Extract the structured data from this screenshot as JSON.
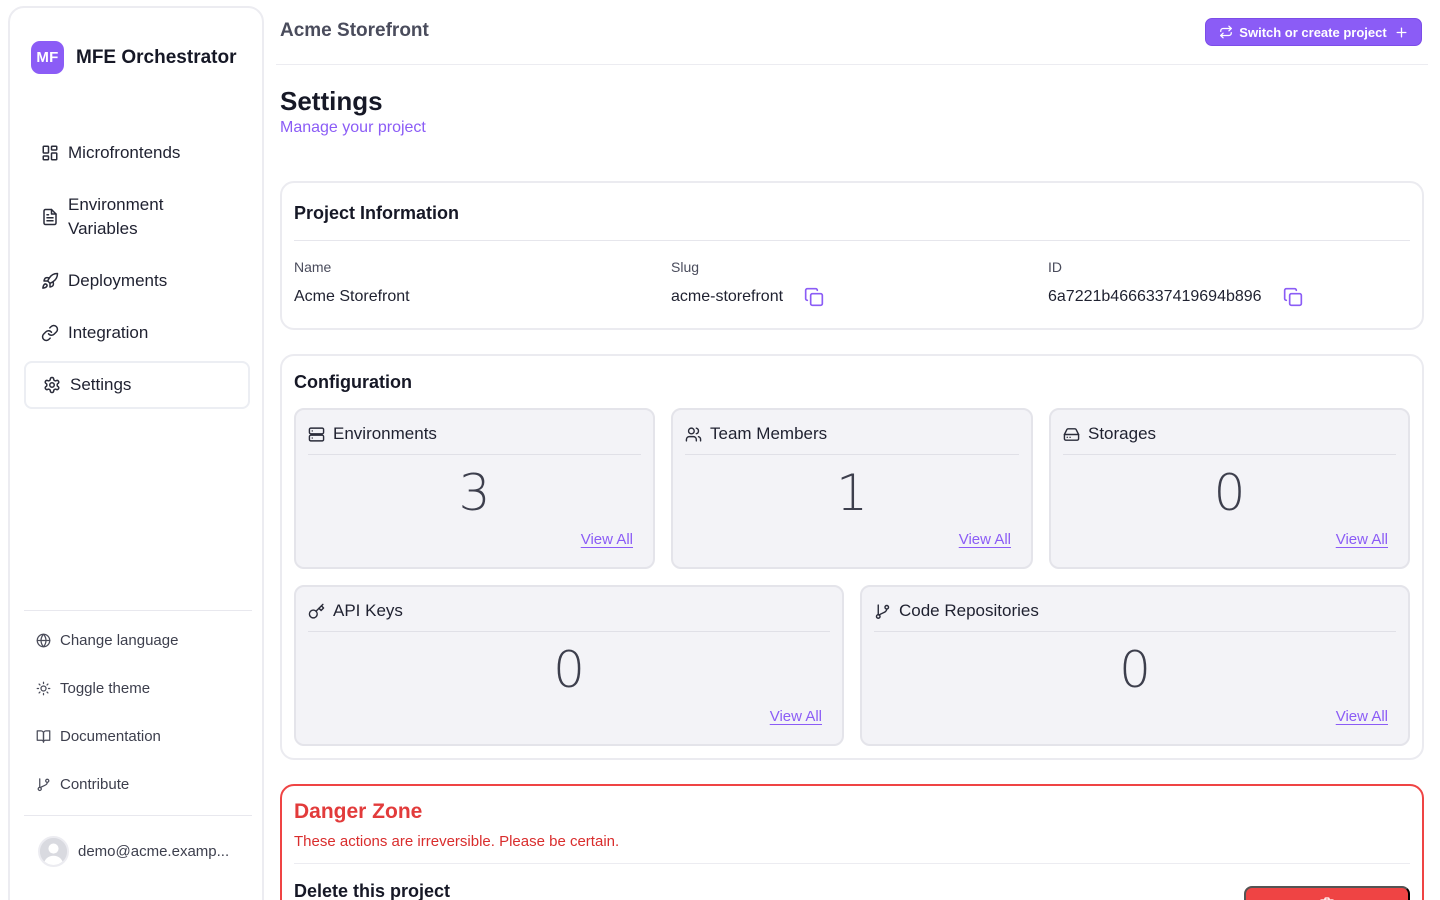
{
  "app": {
    "logo_text": "MF",
    "name": "MFE Orchestrator",
    "accent_color": "#8b5cf6",
    "danger_color": "#ef4444"
  },
  "sidebar": {
    "nav": [
      {
        "label": "Microfrontends",
        "icon": "layout-grid-icon"
      },
      {
        "label": "Environment Variables",
        "icon": "file-text-icon"
      },
      {
        "label": "Deployments",
        "icon": "rocket-icon"
      },
      {
        "label": "Integration",
        "icon": "link-icon"
      },
      {
        "label": "Settings",
        "icon": "gear-icon",
        "active": true
      }
    ],
    "utilities": [
      {
        "label": "Change language",
        "icon": "globe-icon"
      },
      {
        "label": "Toggle theme",
        "icon": "sun-icon"
      },
      {
        "label": "Documentation",
        "icon": "book-open-icon"
      },
      {
        "label": "Contribute",
        "icon": "git-branch-icon"
      }
    ],
    "user_email": "demo@acme.examp..."
  },
  "topbar": {
    "project_name": "Acme Storefront",
    "switch_button": "Switch or create project"
  },
  "page": {
    "title": "Settings",
    "subtitle": "Manage your project"
  },
  "project_info": {
    "title": "Project Information",
    "name_label": "Name",
    "name_value": "Acme Storefront",
    "slug_label": "Slug",
    "slug_value": "acme-storefront",
    "id_label": "ID",
    "id_value": "6a7221b4666337419694b896"
  },
  "configuration": {
    "title": "Configuration",
    "view_all": "View All",
    "stats": [
      {
        "label": "Environments",
        "value": "3",
        "icon": "server-icon"
      },
      {
        "label": "Team Members",
        "value": "1",
        "icon": "users-icon"
      },
      {
        "label": "Storages",
        "value": "0",
        "icon": "hard-drive-icon"
      },
      {
        "label": "API Keys",
        "value": "0",
        "icon": "key-icon"
      },
      {
        "label": "Code Repositories",
        "value": "0",
        "icon": "git-branch-icon"
      }
    ]
  },
  "danger_zone": {
    "title": "Danger Zone",
    "description": "These actions are irreversible. Please be certain.",
    "delete_heading": "Delete this project"
  }
}
